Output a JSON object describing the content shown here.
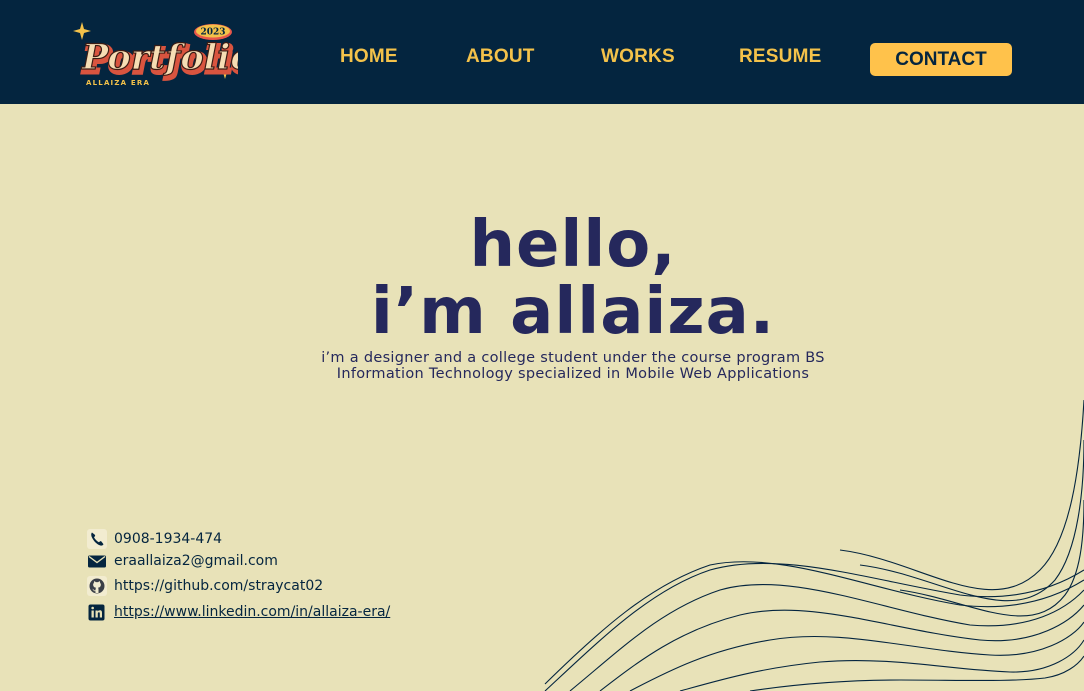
{
  "logo": {
    "year": "2023",
    "wordmark": "Portfolio",
    "owner": "ALLAIZA ERA"
  },
  "nav": {
    "home": "HOME",
    "about": "ABOUT",
    "works": "WORKS",
    "resume": "RESUME",
    "contact": "CONTACT"
  },
  "hero": {
    "line1": "hello,",
    "line2": "i’m allaiza.",
    "subtitle": "i’m a designer and a college student under the course program BS Information Technology specialized in Mobile Web Applications"
  },
  "contacts": {
    "phone": "0908-1934-474",
    "email": "eraallaiza2@gmail.com",
    "github": "https://github.com/straycat02",
    "linkedin": "https://www.linkedin.com/in/allaiza-era/"
  },
  "icons": {
    "phone": "phone-icon",
    "email": "envelope-icon",
    "github": "github-icon",
    "linkedin": "linkedin-icon"
  },
  "colors": {
    "background": "#e8e2b8",
    "navbar": "#04253f",
    "accent": "#ffc24b",
    "heading": "#25285c"
  }
}
